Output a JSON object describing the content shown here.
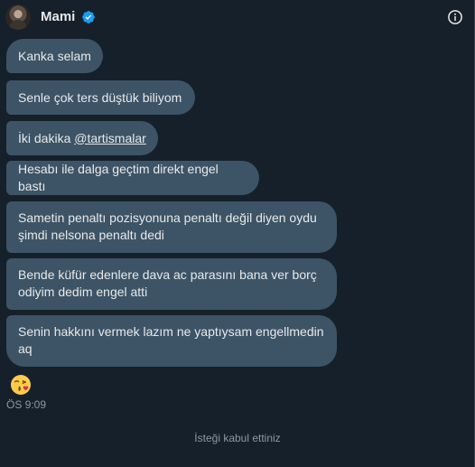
{
  "header": {
    "name": "Mami",
    "verified_color": "#1d9bf0",
    "avatar_icon": "avatar",
    "info_icon": "info-icon"
  },
  "messages": [
    {
      "text": "Kanka selam"
    },
    {
      "text": "Senle çok ters düştük biliyom"
    },
    {
      "text_prefix": "İki dakika ",
      "mention": "@tartismalar"
    },
    {
      "text": "Hesabı ile dalga geçtim direkt engel bastı"
    },
    {
      "line1": "Sametin penaltı pozisyonuna penaltı değil diyen oydu",
      "line2": "şimdi nelsona penaltı dedi"
    },
    {
      "line1": "Bende küfür edenlere dava ac parasını bana ver borç",
      "line2": "odiyim dedim engel atti"
    },
    {
      "line1": "Senin hakkını vermek lazım ne yaptıysam engellmedin",
      "line2": "aq"
    }
  ],
  "reaction_emoji": "face-blowing-kiss-emoji",
  "timestamp": "ÖS 9:09",
  "status_note": "İsteği kabul ettiniz",
  "colors": {
    "background": "#15202b",
    "bubble": "#3d5466",
    "text": "#e7e9ea",
    "muted": "#8b98a5"
  }
}
